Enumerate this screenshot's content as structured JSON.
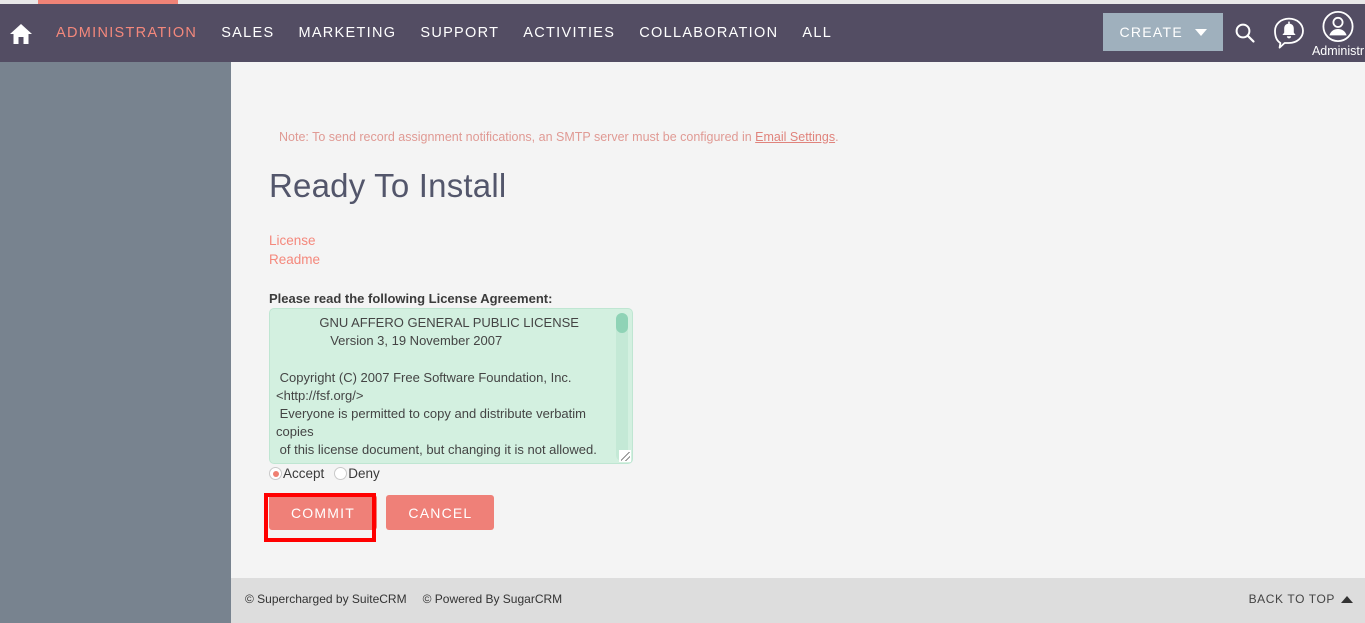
{
  "navbar": {
    "home_icon": "home-icon",
    "items": [
      {
        "label": "ADMINISTRATION",
        "active": true
      },
      {
        "label": "SALES",
        "active": false
      },
      {
        "label": "MARKETING",
        "active": false
      },
      {
        "label": "SUPPORT",
        "active": false
      },
      {
        "label": "ACTIVITIES",
        "active": false
      },
      {
        "label": "COLLABORATION",
        "active": false
      },
      {
        "label": "ALL",
        "active": false
      }
    ],
    "create_label": "CREATE",
    "search_icon": "search-icon",
    "notification_icon": "notification-bell-icon",
    "user_avatar_icon": "user-avatar-icon",
    "user_name": "Administr"
  },
  "colors": {
    "navbar_bg": "#534d63",
    "accent": "#f4887c",
    "sidebar_bg": "#78838f",
    "content_bg": "#f4f4f4",
    "footer_bg": "#dddddd",
    "license_bg": "#d3f0e0",
    "button_bg": "#ef8078",
    "create_button_bg": "#9fb0bd",
    "highlight_border": "#ff0000"
  },
  "main": {
    "note_prefix": "Note: To send record assignment notifications, an SMTP server must be configured in ",
    "note_link": "Email Settings",
    "note_suffix": ".",
    "title": "Ready To Install",
    "doc_links": [
      {
        "label": "License"
      },
      {
        "label": "Readme"
      }
    ],
    "license_label": "Please read the following License Agreement:",
    "license_text": "            GNU AFFERO GENERAL PUBLIC LICENSE\n               Version 3, 19 November 2007\n\n Copyright (C) 2007 Free Software Foundation, Inc. <http://fsf.org/>\n Everyone is permitted to copy and distribute verbatim copies\n of this license document, but changing it is not allowed.",
    "radios": [
      {
        "label": "Accept",
        "checked": true
      },
      {
        "label": "Deny",
        "checked": false
      }
    ],
    "commit_label": "COMMIT",
    "cancel_label": "CANCEL"
  },
  "footer": {
    "supercharged": "© Supercharged by SuiteCRM",
    "powered": "© Powered By SugarCRM",
    "back_to_top": "BACK TO TOP"
  }
}
